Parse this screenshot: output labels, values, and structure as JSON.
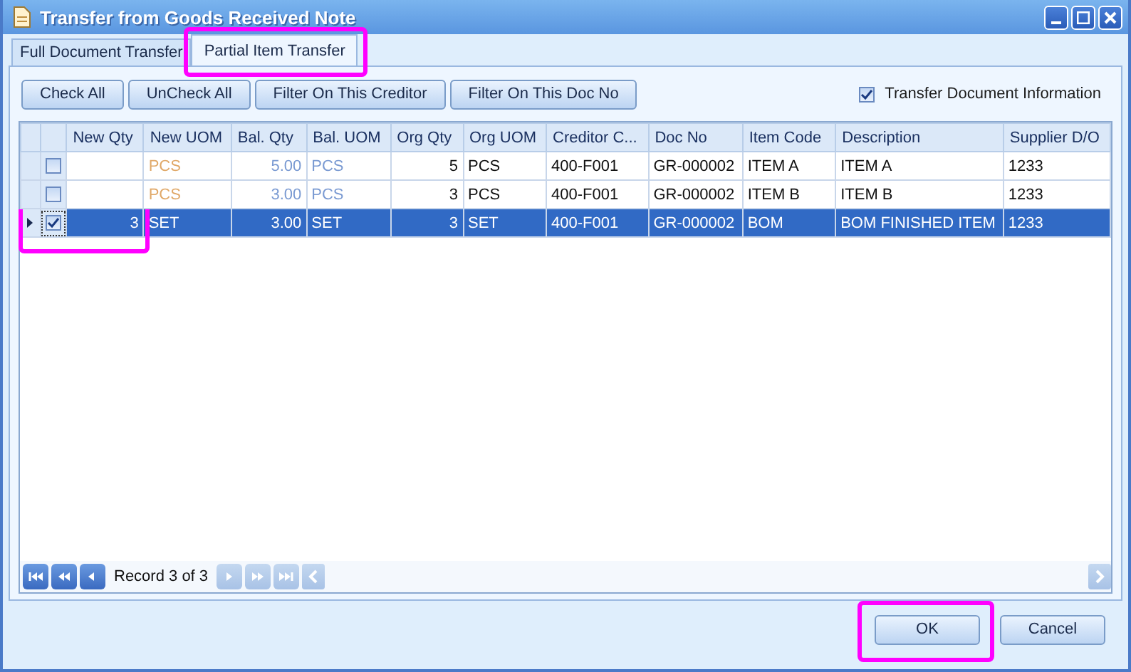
{
  "window": {
    "title": "Transfer from Goods Received Note"
  },
  "tabs": [
    {
      "label": "Full Document Transfer",
      "selected": false
    },
    {
      "label": "Partial Item Transfer",
      "selected": true
    }
  ],
  "toolbar": {
    "buttons": [
      "Check All",
      "UnCheck All",
      "Filter On This Creditor",
      "Filter On This Doc No"
    ],
    "transfer_info": {
      "label": "Transfer Document Information",
      "checked": true
    }
  },
  "table": {
    "columns": [
      "New Qty",
      "New UOM",
      "Bal. Qty",
      "Bal. UOM",
      "Org Qty",
      "Org UOM",
      "Creditor C...",
      "Doc No",
      "Item Code",
      "Description",
      "Supplier D/O"
    ],
    "rows": [
      {
        "selected": false,
        "checked": false,
        "cells": {
          "new_uom": "PCS",
          "bal_qty": "5.00",
          "bal_uom": "PCS",
          "org_qty": "5",
          "org_uom": "PCS",
          "creditor": "400-F001",
          "doc_no": "GR-000002",
          "item_code": "ITEM A",
          "description": "ITEM A",
          "supplier_do": "1233"
        }
      },
      {
        "selected": false,
        "checked": false,
        "cells": {
          "new_uom": "PCS",
          "bal_qty": "3.00",
          "bal_uom": "PCS",
          "org_qty": "3",
          "org_uom": "PCS",
          "creditor": "400-F001",
          "doc_no": "GR-000002",
          "item_code": "ITEM B",
          "description": "ITEM B",
          "supplier_do": "1233"
        }
      },
      {
        "selected": true,
        "checked": true,
        "cells": {
          "new_qty": "3",
          "new_uom": "SET",
          "bal_qty": "3.00",
          "bal_uom": "SET",
          "org_qty": "3",
          "org_uom": "SET",
          "creditor": "400-F001",
          "doc_no": "GR-000002",
          "item_code": "BOM",
          "description": "BOM FINISHED ITEM",
          "supplier_do": "1233"
        }
      }
    ]
  },
  "navigator": {
    "buttons": [
      {
        "kind": "first",
        "disabled": false
      },
      {
        "kind": "prev_page",
        "disabled": false
      },
      {
        "kind": "prev",
        "disabled": false
      },
      {
        "kind": "next",
        "disabled": true
      },
      {
        "kind": "next_page",
        "disabled": true
      },
      {
        "kind": "last",
        "disabled": true
      }
    ],
    "text": "Record 3 of 3"
  },
  "dialog_buttons": [
    "OK",
    "Cancel"
  ]
}
